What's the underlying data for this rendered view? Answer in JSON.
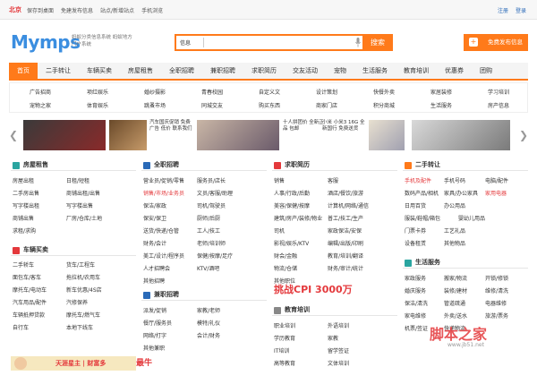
{
  "topbar": {
    "city": "北京",
    "links": [
      "保存到桌面",
      "免建发布信息",
      "站点/新增站点",
      "手机浏览"
    ],
    "account": [
      "注册",
      "登录"
    ]
  },
  "logo": {
    "text": "Mymps",
    "slogan": "蚂蚁分类信息系统 蚂蚁地方门户系统"
  },
  "search": {
    "category": "信息",
    "button": "搜索"
  },
  "publish": {
    "label": "免费发布信息",
    "icon": "+"
  },
  "nav": [
    "首页",
    "二手转让",
    "车辆买卖",
    "房屋租售",
    "全职招聘",
    "兼职招聘",
    "求职简历",
    "交友活动",
    "宠物",
    "生活服务",
    "教育培训",
    "优惠券",
    "团购"
  ],
  "subcats": {
    "row1": [
      "广告招商",
      "项红娱乐",
      "婚纱摄影",
      "青春校园",
      "自定义文",
      "设计策划",
      "快餐外卖",
      "家居装修",
      "学习培训"
    ],
    "row2": [
      "宠物之家",
      "体育娱乐",
      "跳蚤市场",
      "同城交友",
      "购买东西",
      "商家门店",
      "积分商城",
      "生活服务",
      "房产信息"
    ]
  },
  "banner": {
    "ads": [
      {
        "text": ""
      },
      {
        "text": "汽车国庆促销 免费广告 低价 联系我们"
      },
      {
        "text": ""
      },
      {
        "text": "十人拼团价 全新正品 包邮"
      },
      {
        "text": "小米 小米3 16G 全新国行 免费送货"
      },
      {
        "text": ""
      }
    ]
  },
  "sections": {
    "house": {
      "title": "房屋租售",
      "links": [
        "房屋出租",
        "日租/短租",
        "二手房出售",
        "商铺出租/出售",
        "写字楼出租",
        "写字楼出售",
        "商铺出售",
        "厂房/仓库/土地",
        "求租/求购",
        ""
      ]
    },
    "cars": {
      "title": "车辆买卖",
      "links": [
        "二手轿车",
        "货车/工程车",
        "面包车/客车",
        "拖拉机/农用车",
        "摩托车/电动车",
        "新车优惠/4S店",
        "汽车用品/配件",
        "汽修保养",
        "车辆抵押贷款",
        "摩托车/燃气车",
        "自行车",
        "本地下线车"
      ]
    },
    "fulltime": {
      "title": "全职招聘",
      "links": [
        "营业员/促销/零售",
        "服务员/店长",
        "销售/市场/业务员",
        "文员/客服/助理",
        "保洁/家政",
        "司机/驾驶员",
        "保安/保卫",
        "厨师/后厨",
        "送货/快递/仓管",
        "工人/技工",
        "财务/会计",
        "老师/培训师",
        "美工/设计/程序员",
        "保健/按摩/足疗",
        "人才招聘会",
        "KTV/酒吧",
        "其他招聘",
        ""
      ]
    },
    "parttime": {
      "title": "兼职招聘",
      "links": [
        "派发/促销",
        "家教/老师",
        "餐厅/服务员",
        "模特/礼仪",
        "网络/打字",
        "会计/财务",
        "其他兼职",
        ""
      ]
    },
    "resume": {
      "title": "求职简历",
      "links": [
        "销售",
        "客服",
        "人事/行政/后勤",
        "酒店/餐饮/旅游",
        "美容/保健/按摩",
        "计算机/网络/通信",
        "建筑/房产/装修/物业",
        "普工/技工/生产",
        "司机",
        "家政保洁/安保",
        "影视/娱乐/KTV",
        "编辑/出版/印刷",
        "财会/金融",
        "教育/培训/翻译",
        "物流/仓储",
        "财务/审计/统计",
        "其他职位",
        ""
      ]
    },
    "edu": {
      "title": "教育培训",
      "links": [
        "职业培训",
        "外语培训",
        "学历教育",
        "家教",
        "IT培训",
        "留学签证",
        "高等教育",
        "文体培训"
      ]
    },
    "secondhand": {
      "title": "二手转让",
      "links": [
        "手机及配件",
        "手机号码",
        "电脑/配件",
        "数码产品/相机",
        "家具/办公家具",
        "家用电器",
        "日用百货",
        "办公用品",
        "服装/鞋帽/箱包",
        "婴幼儿用品",
        "门票卡券",
        "工艺礼品",
        "设备租赁",
        "其他物品",
        "",
        ""
      ]
    },
    "life": {
      "title": "生活服务",
      "links": [
        "家政服务",
        "搬家/物流",
        "开锁/修锁",
        "婚庆服务",
        "装修/建材",
        "维修/清洗",
        "保洁/清洗",
        "管道疏通",
        "电器维修",
        "家电维修",
        "外卖/送水",
        "旅游/票务",
        "机票/签证",
        "快递物流",
        "",
        ""
      ]
    }
  },
  "promo": {
    "text": "天涯星主 | 财富多",
    "big": "最牛"
  },
  "cpi": "挑战CPI 3000万",
  "watermark": {
    "big": "脚本之家",
    "url": "www.jb51.net"
  }
}
